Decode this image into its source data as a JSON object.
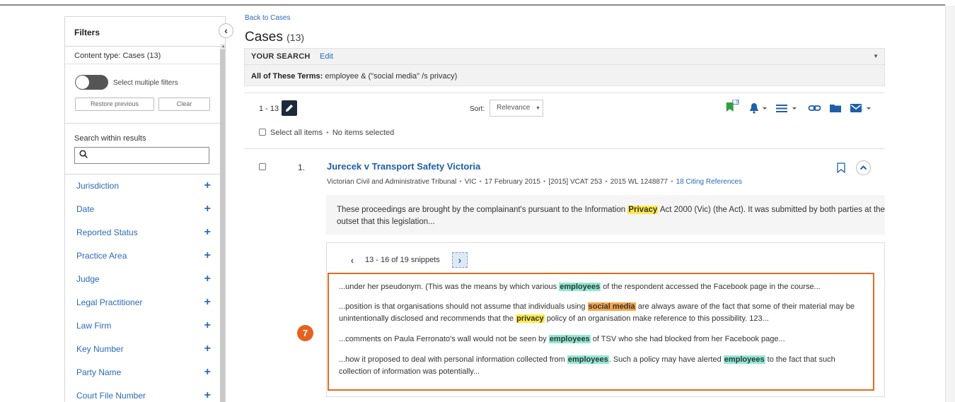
{
  "sidebar": {
    "title": "Filters",
    "content_type": "Content type: Cases (13)",
    "toggle_label": "Select multiple filters",
    "restore_label": "Restore previous",
    "clear_label": "Clear",
    "search_within_label": "Search within results",
    "search_within_value": "",
    "facets": [
      {
        "label": "Jurisdiction"
      },
      {
        "label": "Date"
      },
      {
        "label": "Reported Status"
      },
      {
        "label": "Practice Area"
      },
      {
        "label": "Judge"
      },
      {
        "label": "Legal Practitioner"
      },
      {
        "label": "Law Firm"
      },
      {
        "label": "Key Number"
      },
      {
        "label": "Party Name"
      },
      {
        "label": "Court File Number"
      }
    ],
    "facet_expand_symbol": "+",
    "collapse_symbol": "‹"
  },
  "header": {
    "back_link": "Back to Cases",
    "title": "Cases",
    "count": "(13)"
  },
  "your_search": {
    "heading": "YOUR SEARCH",
    "edit": "Edit",
    "terms_label": "All of These Terms:",
    "terms_value": "employee & (\"social media\" /s privacy)"
  },
  "toolbar": {
    "range": "1 - 13",
    "sort_label": "Sort:",
    "sort_value": "Relevance",
    "folder_badge": "0",
    "select_all": "Select all items",
    "no_items": "No items selected"
  },
  "result": {
    "number": "1.",
    "title": "Jurecek v Transport Safety Victoria",
    "meta": {
      "tribunal": "Victorian Civil and Administrative Tribunal",
      "jurisdiction": "VIC",
      "date": "17 February 2015",
      "citation": "[2015] VCAT 253",
      "wl": "2015 WL 1248877",
      "citing": "18 Citing References"
    },
    "summary": {
      "pre": "These proceedings are brought by the complainant's pursuant to the Information ",
      "hl": "Privacy",
      "post": " Act 2000 (Vic) (the Act). It was submitted by both parties at the outset that this legislation..."
    }
  },
  "snippets": {
    "range": "13 - 16 of 19 snippets",
    "s1": {
      "a": "...under her pseudonym. (This was the means by which various ",
      "h1": "employees",
      "b": " of the respondent accessed the Facebook page in the course..."
    },
    "s2": {
      "a": "...position is that organisations should not assume that individuals using ",
      "h1": "social media",
      "b": " are always aware of the fact that some of their material may be unintentionally disclosed and recommends that the ",
      "h2": "privacy",
      "c": " policy of an organisation make reference to this possibility. 123..."
    },
    "s3": {
      "a": "...comments on Paula Ferronato's wall would not be seen by ",
      "h1": "employees",
      "b": " of TSV who she had blocked from her Facebook page..."
    },
    "s4": {
      "a": "...how it proposed to deal with personal information collected from ",
      "h1": "employees",
      "b": ". Such a policy may have alerted ",
      "h2": "employees",
      "c": " to the fact that such collection of information was potentially..."
    }
  },
  "callout": "7",
  "colors": {
    "link": "#2a6ab8",
    "callout": "#e5621f",
    "highlight_yellow": "#ffe94c",
    "highlight_green": "#8fe9d3",
    "highlight_orange": "#f7a64e",
    "flag_green": "#2e9e3e",
    "icon_blue": "#1f5fa8"
  }
}
